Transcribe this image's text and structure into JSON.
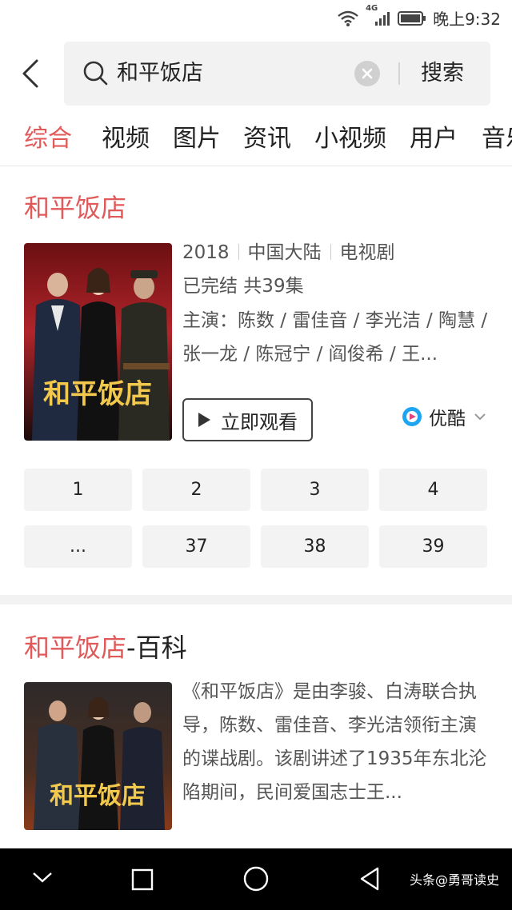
{
  "status_bar": {
    "network": "4G",
    "time": "晚上9:32"
  },
  "search": {
    "query": "和平饭店",
    "submit_label": "搜索"
  },
  "tabs": [
    "综合",
    "视频",
    "图片",
    "资讯",
    "小视频",
    "用户",
    "音乐"
  ],
  "active_tab": "综合",
  "result": {
    "title": "和平饭店",
    "year": "2018",
    "region": "中国大陆",
    "category": "电视剧",
    "status": "已完结 共39集",
    "cast": "主演：陈数 / 雷佳音 / 李光洁 / 陶慧 / 张一龙 / 陈冠宁 / 阎俊希 / 王...",
    "poster_caption": "和平饭店",
    "watch_label": "立即观看",
    "source_label": "优酷",
    "episodes": [
      "1",
      "2",
      "3",
      "4",
      "...",
      "37",
      "38",
      "39"
    ]
  },
  "baike": {
    "title_highlight": "和平饭店",
    "title_rest": "-百科",
    "description": "《和平饭店》是由李骏、白涛联合执导，陈数、雷佳音、李光洁领衔主演的谍战剧。该剧讲述了1935年东北沦陷期间，民间爱国志士王..."
  },
  "watermark": "头条@勇哥读史",
  "colors": {
    "accent": "#e05a5a",
    "search_bg": "#f2f2f2",
    "episode_bg": "#f3f3f3",
    "navbar_bg": "#000000"
  }
}
